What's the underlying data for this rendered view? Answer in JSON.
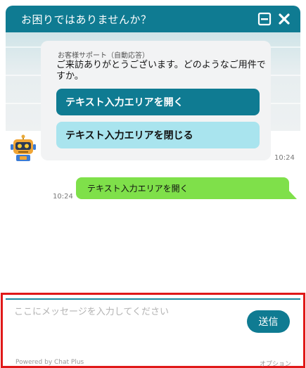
{
  "header": {
    "title": "お困りではありませんか？",
    "minimize_icon": "minimize-icon",
    "close_icon": "close-icon",
    "color": "#0f7b92"
  },
  "bot_message": {
    "sender": "お客様サポート（自動応答）",
    "text": "ご来訪ありがとうございます。どのようなご用件ですか。",
    "buttons": [
      {
        "label": "テキスト入力エリアを開く"
      },
      {
        "label": "テキスト入力エリアを閉じる"
      }
    ],
    "time": "10:24",
    "avatar_icon": "robot-icon"
  },
  "user_message": {
    "text": "テキスト入力エリアを開く",
    "time": "10:24",
    "color": "#7fe04a"
  },
  "input": {
    "placeholder": "ここにメッセージを入力してください",
    "value": "",
    "send_label": "送信"
  },
  "footer": {
    "powered_by": "Powered by Chat Plus",
    "options": "オプション"
  },
  "highlight_color": "#e01919"
}
